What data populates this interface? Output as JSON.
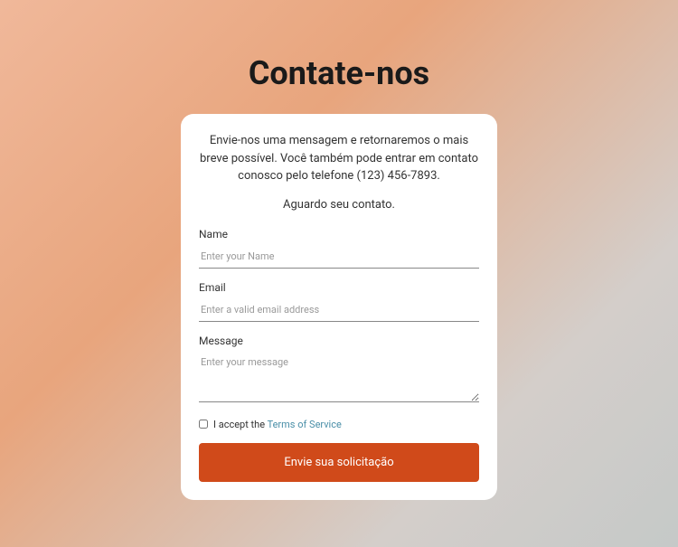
{
  "title": "Contate-nos",
  "intro": "Envie-nos uma mensagem e retornaremos o mais breve possível. Você também pode entrar em contato conosco pelo telefone (123) 456-7893.",
  "subtitle": "Aguardo seu contato.",
  "form": {
    "name": {
      "label": "Name",
      "placeholder": "Enter your Name"
    },
    "email": {
      "label": "Email",
      "placeholder": "Enter a valid email address"
    },
    "message": {
      "label": "Message",
      "placeholder": "Enter your message"
    },
    "checkbox": {
      "prefix": "I accept the ",
      "link": "Terms of Service"
    },
    "submit": "Envie sua solicitação"
  }
}
